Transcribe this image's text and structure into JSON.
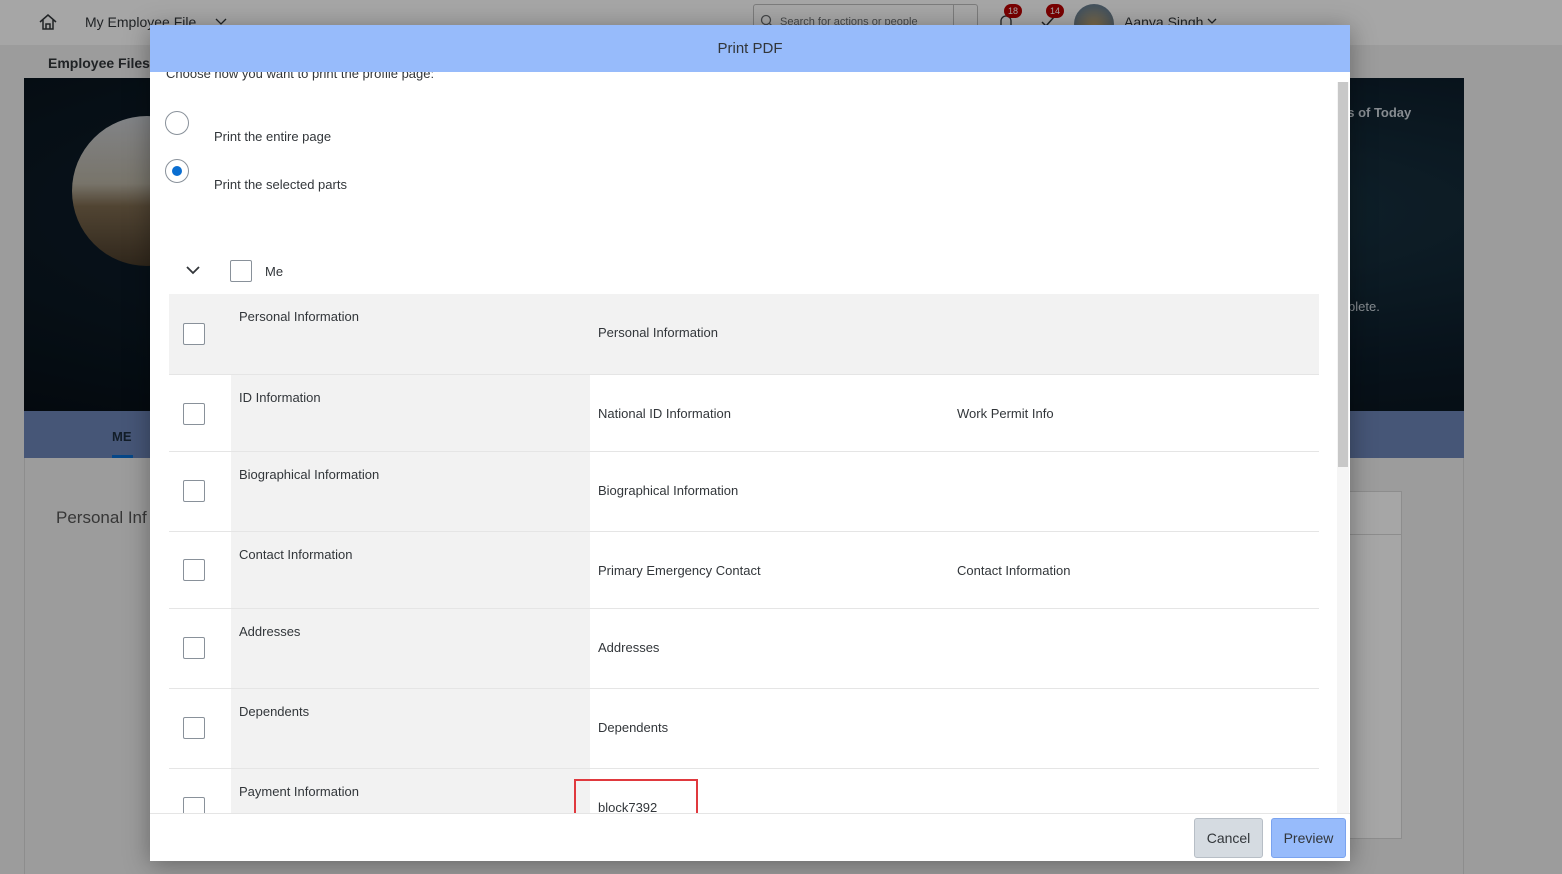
{
  "shell": {
    "app_title": "My Employee File",
    "search_placeholder": "Search for actions or people",
    "notifications_count": "18",
    "tasks_count": "14",
    "user_name": "Aanya Singh"
  },
  "page": {
    "section_title": "Employee Files",
    "hero_as_of": "as of Today",
    "hero_partial": "plete.",
    "tab_me": "ME",
    "personal_info_heading": "Personal Inf"
  },
  "dialog": {
    "title": "Print PDF",
    "instruction": "Choose how you want to print the profile page:",
    "options": [
      {
        "label": "Print the entire page",
        "selected": false
      },
      {
        "label": "Print the selected parts",
        "selected": true
      }
    ],
    "tree_root": "Me",
    "rows": [
      {
        "label": "Personal Information",
        "subs": [
          "Personal Information"
        ]
      },
      {
        "label": "ID Information",
        "subs": [
          "National ID Information",
          "Work Permit Info"
        ]
      },
      {
        "label": "Biographical Information",
        "subs": [
          "Biographical Information"
        ]
      },
      {
        "label": "Contact Information",
        "subs": [
          "Primary Emergency Contact",
          "Contact Information"
        ]
      },
      {
        "label": "Addresses",
        "subs": [
          "Addresses"
        ]
      },
      {
        "label": "Dependents",
        "subs": [
          "Dependents"
        ]
      },
      {
        "label": "Payment Information",
        "subs": [
          "block7392"
        ]
      }
    ],
    "buttons": {
      "cancel": "Cancel",
      "preview": "Preview"
    },
    "colors": {
      "header": "#97bbfb",
      "highlight": "#e0393e",
      "radio_selected": "#0a6ed1"
    }
  }
}
